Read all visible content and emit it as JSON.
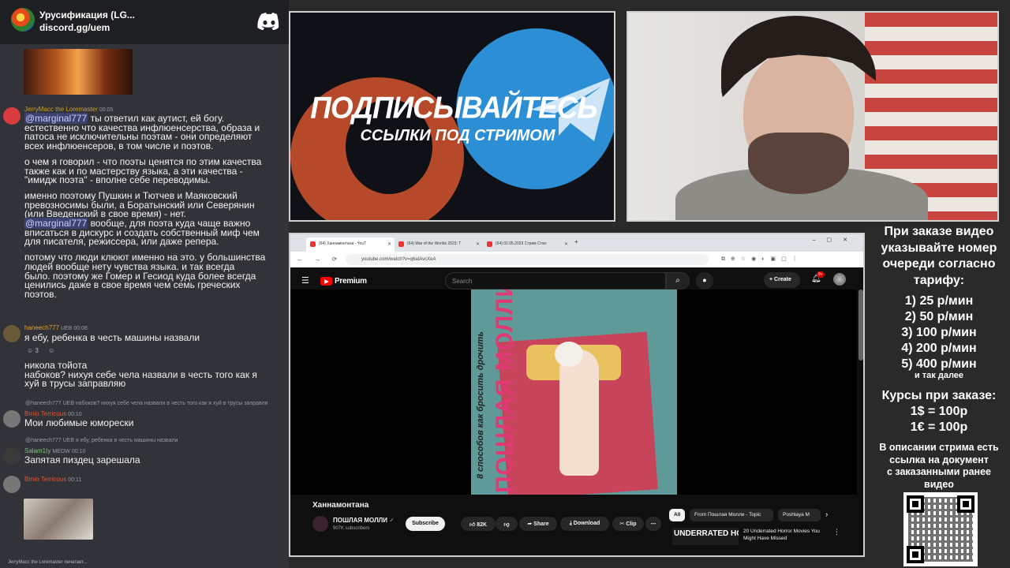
{
  "chat": {
    "server_name": "Урусификация (LG...",
    "server_invite": "discord.gg/uem",
    "messages": [
      {
        "user": "JerryMacc the Loremaster",
        "time": "00:05",
        "user_color": "#c9a227",
        "lines": [
          "@marginal777 ты ответил как аутист, ей богу.",
          "естественно что качества  инфлюенсерства, образа и",
          "патоса не исключительны поэтам - они определяют",
          "всех инфлюенсеров, в том числе и поэтов.",
          "",
          "о чем я говорил - что поэты ценятся по этим качества",
          "также как и по мастерству языка, а эти качества -",
          "\"имидж поэта\" - вполне себе переводимы.",
          "",
          "именно поэтому Пушкин и Тютчев и Маяковский",
          "превозносимы были, а Боратынский или Северянин",
          "(или Введенский в свое время) - нет.",
          "@marginal777 вообще, для поэта куда чаще важно",
          "вписаться в дискурс и создать собственный миф чем",
          "для писателя, режиссера, или даже репера.",
          "",
          "потому что люди клюют именно на это. у большинства",
          "людей вообще нету чувства языка. и так всегда",
          "было. поэтому же Гомер и Гесиод куда более всегда",
          "ценились даже в свое время чем семь греческих",
          "поэтов."
        ]
      },
      {
        "user": "haneech777",
        "badge": "UEB",
        "time": "00:08",
        "user_color": "#e0a030",
        "lines": [
          "я ебу, ребенка в честь машины назвали"
        ],
        "reactions": "3"
      },
      {
        "user": "",
        "lines": [
          "никола тойота",
          "набоков? нихуя себе чела назвали в честь того как я",
          "хуй в трусы заправляю"
        ]
      },
      {
        "reply": "@haneech777  UEB  набоков? нихуя себе чела назвали в честь того как я хуй в трусы заправля",
        "user": "Brnio Terricous",
        "time": "00:10",
        "user_color": "#e05a3a",
        "lines": [
          "Мои любимые юморески"
        ]
      },
      {
        "reply": "@haneech777  UEB  я ебу, ребенка в честь машины назвали",
        "user": "Salam1ty",
        "badge": "MEOW",
        "time": "00:10",
        "user_color": "#7bc67b",
        "lines": [
          "Запятая пиздец зарешала"
        ]
      },
      {
        "user": "Brnio Terricous",
        "time": "00:11",
        "user_color": "#e05a3a",
        "lines": []
      }
    ],
    "typing": "JerryMacc the Loremaster печатает..."
  },
  "banner": {
    "title": "ПОДПИСЫВАЙТЕСЬ",
    "subtitle": "ССЫЛКИ ПОД СТРИМОМ"
  },
  "browser": {
    "tabs": [
      {
        "label": "(64) Ханнамонтана - YouT"
      },
      {
        "label": "(64) War of the Worlds 2023: Т"
      },
      {
        "label": "(64) 02.05.2023 Стрим Стал"
      }
    ],
    "url": "youtube.com/watch?v=q6aIAvcXeA",
    "youtube": {
      "logo": "Premium",
      "search_placeholder": "Search",
      "create_label": "Create",
      "notif_count": "9+",
      "video_title": "Ханнамонтана",
      "cover_title": "ПОШЛАЯ МОЛЛИ",
      "cover_subtitle": "8 способов как бросить дрочить",
      "channel_name": "ПОШЛАЯ МОЛЛИ",
      "channel_subs": "907K subscribers",
      "subscribe_label": "Subscribe",
      "like_count": "82K",
      "share_label": "Share",
      "download_label": "Download",
      "clip_label": "Clip",
      "chips": [
        "All",
        "From Пошлая Молли - Topic",
        "Poshlaya M"
      ],
      "rec_thumb_text": "UNDERRATED HORROR",
      "rec_title": "20 Underrated Horror Movies You Might Have Missed"
    }
  },
  "info": {
    "head": [
      "При заказе видео",
      "указывайте номер",
      "очереди согласно",
      "тарифу:"
    ],
    "tariffs": [
      "1) 25 р/мин",
      "2) 50 р/мин",
      "3) 100 р/мин",
      "4) 200 р/мин",
      "5) 400 р/мин"
    ],
    "tariff_more": "и так далее",
    "courses": [
      "Курсы при заказе:",
      "1$ = 100р",
      "1€ = 100р"
    ],
    "desc": [
      "В описании стрима есть",
      "ссылка на документ",
      "с заказанными ранее",
      "видео"
    ]
  },
  "colors": {
    "discord_bg": "#313338",
    "mention_bg": "#3c4270",
    "youtube_red": "#ff0000",
    "banner_orange": "#b5492a",
    "banner_blue": "#2c8fd6",
    "cover_pink": "#e03a75"
  }
}
